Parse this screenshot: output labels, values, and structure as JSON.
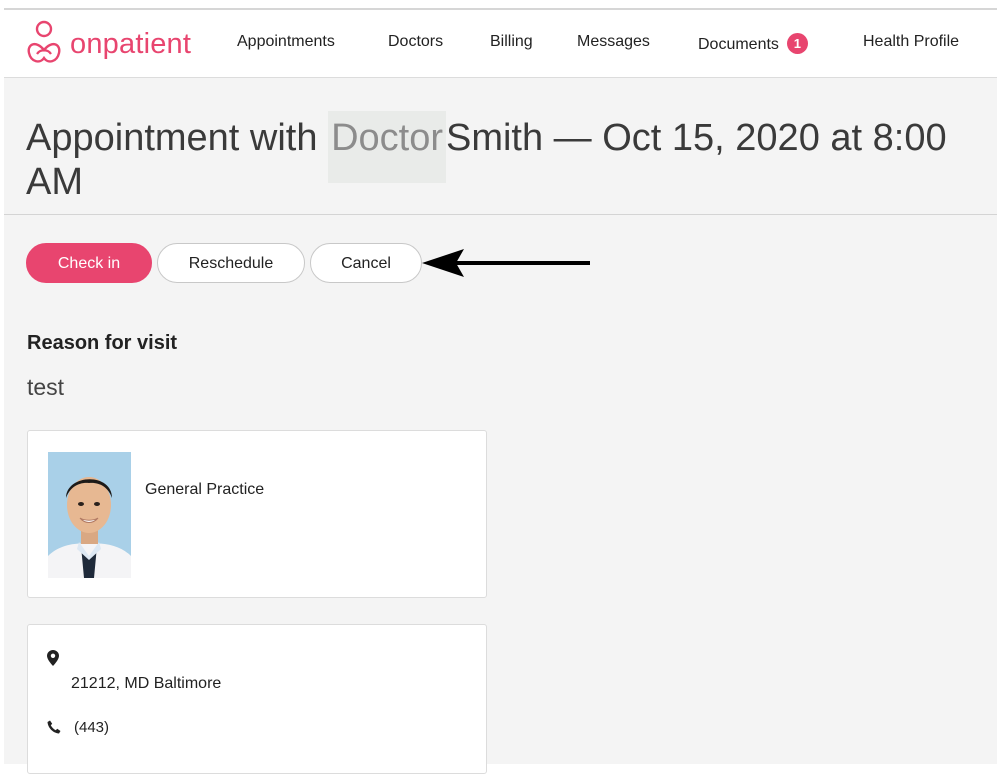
{
  "brand": {
    "name": "onpatient",
    "color": "#e8456f"
  },
  "nav": {
    "items": [
      {
        "label": "Appointments"
      },
      {
        "label": "Doctors"
      },
      {
        "label": "Billing"
      },
      {
        "label": "Messages"
      },
      {
        "label": "Documents",
        "badge": "1"
      },
      {
        "label": "Health Profile"
      }
    ]
  },
  "appointment": {
    "title_prefix": "Appointment with",
    "title_highlight": "Doctor",
    "title_suffix": "Smith — Oct 15, 2020 at 8:00 AM"
  },
  "actions": {
    "check_in": "Check in",
    "reschedule": "Reschedule",
    "cancel": "Cancel"
  },
  "visit": {
    "heading": "Reason for visit",
    "reason": "test"
  },
  "doctor_card": {
    "specialty": "General Practice",
    "photo_icon": "doctor-photo"
  },
  "location_card": {
    "pin_icon": "map-pin-icon",
    "address": "21212, MD Baltimore",
    "phone_icon": "phone-icon",
    "phone": "(443)"
  }
}
